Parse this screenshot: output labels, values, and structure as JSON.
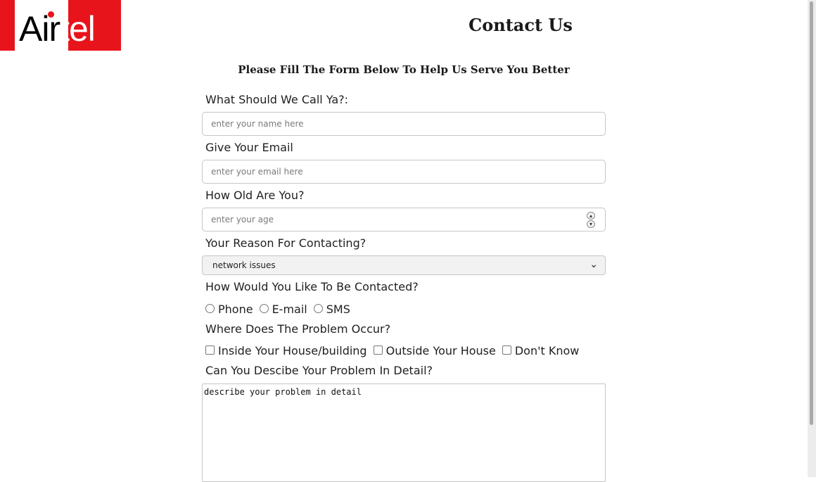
{
  "logo": {
    "part1": "Air",
    "part2": "tel",
    "colors": {
      "brand_red": "#e8141c"
    }
  },
  "header": {
    "title": "Contact Us"
  },
  "form": {
    "subtitle": "Please Fill The Form Below To Help Us Serve You Better",
    "name": {
      "label": "What Should We Call Ya?:",
      "placeholder": "enter your name here",
      "value": ""
    },
    "email": {
      "label": "Give Your Email",
      "placeholder": "enter your email here",
      "value": ""
    },
    "age": {
      "label": "How Old Are You?",
      "placeholder": "enter your age",
      "value": ""
    },
    "reason": {
      "label": "Your Reason For Contacting?",
      "selected": "network issues"
    },
    "contact_method": {
      "label": "How Would You Like To Be Contacted?",
      "options": [
        "Phone",
        "E-mail",
        "SMS"
      ]
    },
    "problem_location": {
      "label": "Where Does The Problem Occur?",
      "options": [
        "Inside Your House/building",
        "Outside Your House",
        "Don't Know"
      ]
    },
    "details": {
      "label": "Can You Descibe Your Problem In Detail?",
      "placeholder": "describe your problem in detail"
    }
  }
}
